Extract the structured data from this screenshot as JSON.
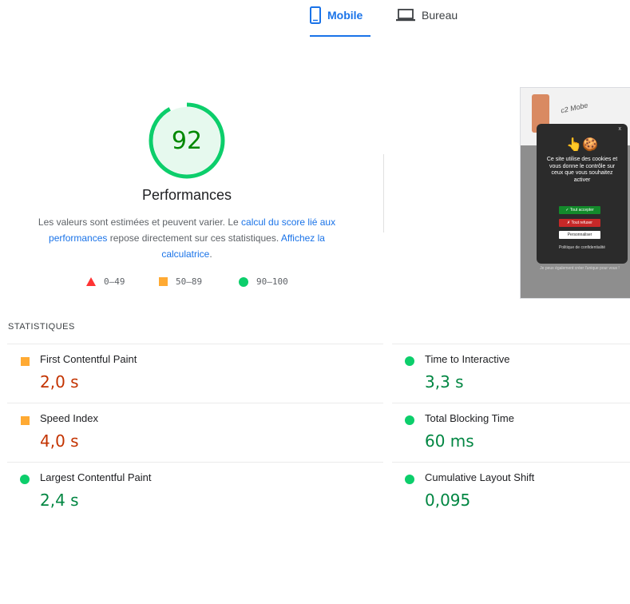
{
  "tabs": [
    {
      "label": "Mobile",
      "icon": "mobile-phone-icon",
      "selected": true
    },
    {
      "label": "Bureau",
      "icon": "laptop-icon",
      "selected": false
    }
  ],
  "score": {
    "value": "92",
    "fraction": 0.92,
    "color": "#0cce6b",
    "title": "Performances",
    "desc_part1": "Les valeurs sont estimées et peuvent varier. Le ",
    "desc_link1": "calcul du score lié aux performances",
    "desc_part2": " repose directement sur ces statistiques. ",
    "desc_link2": "Affichez la calculatrice",
    "desc_end": "."
  },
  "legend": [
    {
      "range": "0–49",
      "shape": "triangle",
      "color": "#ff3333"
    },
    {
      "range": "50–89",
      "shape": "square",
      "color": "#ffaa33"
    },
    {
      "range": "90–100",
      "shape": "circle",
      "color": "#0cce6b"
    }
  ],
  "screenshot": {
    "logo_text": "c2 Mobe",
    "close": "x",
    "emoji": "👆🍪",
    "popup_text": "Ce site utilise des cookies et vous donne le contrôle sur ceux que vous souhaitez activer",
    "accept": "✓ Tout accepter",
    "refuse": "✗ Tout refuser",
    "custom": "Personnaliser",
    "policy": "Politique de confidentialité",
    "bottom_text": "Je peux également créer l'unique pour vous !"
  },
  "stats": {
    "title": "STATISTIQUES",
    "left": [
      {
        "name": "First Contentful Paint",
        "value": "2,0 s",
        "status": "average"
      },
      {
        "name": "Speed Index",
        "value": "4,0 s",
        "status": "average"
      },
      {
        "name": "Largest Contentful Paint",
        "value": "2,4 s",
        "status": "pass"
      }
    ],
    "right": [
      {
        "name": "Time to Interactive",
        "value": "3,3 s",
        "status": "pass"
      },
      {
        "name": "Total Blocking Time",
        "value": "60 ms",
        "status": "pass"
      },
      {
        "name": "Cumulative Layout Shift",
        "value": "0,095",
        "status": "pass"
      }
    ]
  }
}
